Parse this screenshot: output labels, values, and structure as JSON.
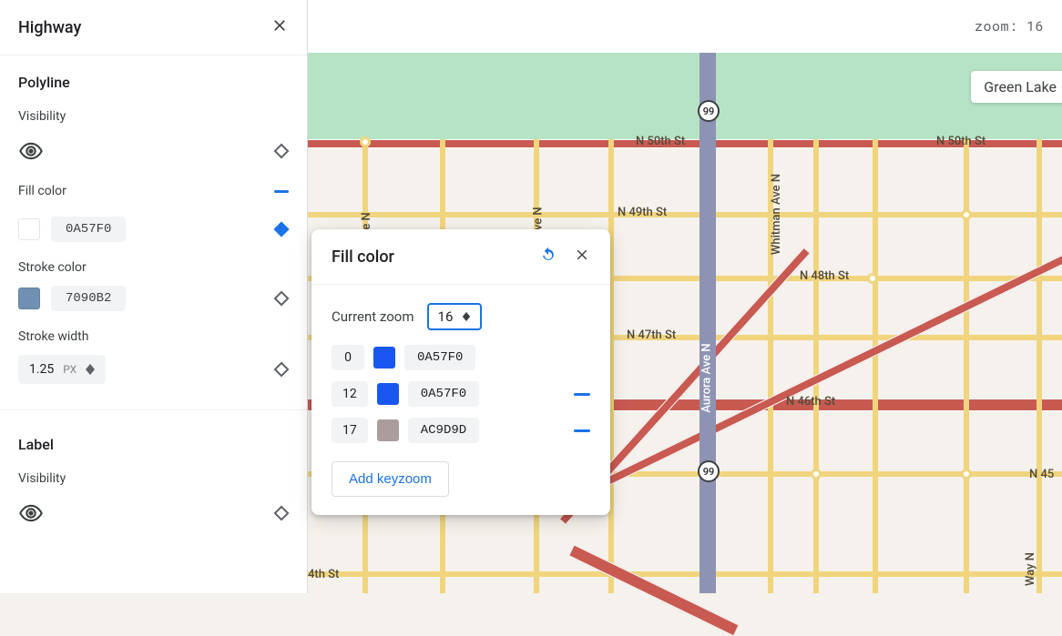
{
  "sidebar": {
    "title": "Highway",
    "polyline": {
      "heading": "Polyline",
      "visibility_label": "Visibility",
      "fill_color_label": "Fill color",
      "fill_color_hex": "0A57F0",
      "fill_color_value": "#0A57F0",
      "stroke_color_label": "Stroke color",
      "stroke_color_hex": "7090B2",
      "stroke_color_value": "#7090B2",
      "stroke_width_label": "Stroke width",
      "stroke_width_value": "1.25",
      "stroke_width_unit": "PX"
    },
    "label": {
      "heading": "Label",
      "visibility_label": "Visibility"
    }
  },
  "zoom_display": "zoom: 16",
  "map": {
    "marker": "Green Lake",
    "shields": [
      "99",
      "99"
    ],
    "streets_h": [
      "N 50th St",
      "N 50th St",
      "N 49th St",
      "N 48th St",
      "N 47th St",
      "N 46th St",
      "4th St",
      "N 45"
    ],
    "streets_v": [
      "ont Ave N",
      "n Ave N",
      "Whitman Ave N",
      "Aurora Ave N",
      "Way N"
    ]
  },
  "popover": {
    "title": "Fill color",
    "current_zoom_label": "Current zoom",
    "current_zoom_value": "16",
    "keyzooms": [
      {
        "zoom": "0",
        "hex": "0A57F0",
        "swatch": "#1a57f0",
        "has_remove": false
      },
      {
        "zoom": "12",
        "hex": "0A57F0",
        "swatch": "#1a57f0",
        "has_remove": true
      },
      {
        "zoom": "17",
        "hex": "AC9D9D",
        "swatch": "#ac9d9d",
        "has_remove": true
      }
    ],
    "add_label": "Add keyzoom"
  }
}
